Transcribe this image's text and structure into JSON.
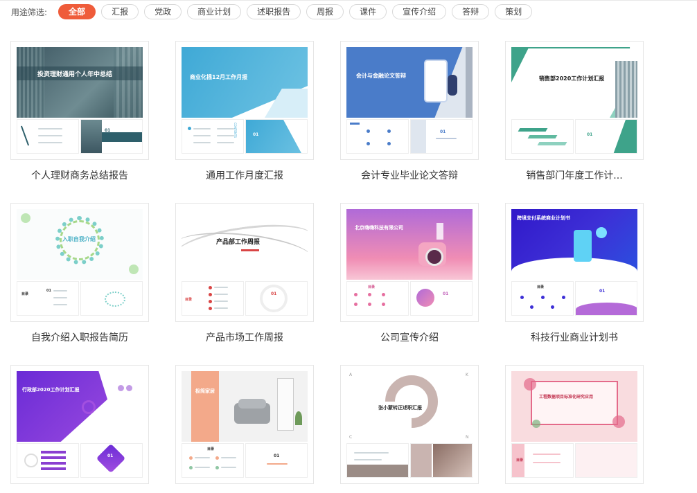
{
  "filter": {
    "label": "用途筛选:",
    "chips": [
      "全部",
      "汇报",
      "党政",
      "商业计划",
      "述职报告",
      "周报",
      "课件",
      "宣传介绍",
      "答辩",
      "策划"
    ],
    "active": "全部"
  },
  "cards": [
    {
      "title": "个人理财商务总结报告",
      "slide_title": "投资理财通用个人年中总结",
      "accent": "#2e5f6b"
    },
    {
      "title": "通用工作月度汇报",
      "slide_title": "商业化插12月工作月报",
      "accent": "#3fa9d6"
    },
    {
      "title": "会计专业毕业论文答辩",
      "slide_title": "会计与金融论文答辩",
      "accent": "#4a7cc9"
    },
    {
      "title": "销售部门年度工作计...",
      "slide_title": "销售部2020工作计划汇报",
      "accent": "#3ea38a"
    },
    {
      "title": "自我介绍入职报告简历",
      "slide_title": "入职自我介绍",
      "accent": "#5fbfc6"
    },
    {
      "title": "产品市场工作周报",
      "slide_title": "产品部工作周报",
      "accent": "#d94545"
    },
    {
      "title": "公司宣传介绍",
      "slide_title": "北京嗨嗨科技有限公司",
      "accent": "#c05fb9"
    },
    {
      "title": "科技行业商业计划书",
      "slide_title": "跨境支付系统商业计划书",
      "accent": "#3d2fd6"
    },
    {
      "title": "",
      "slide_title": "行政部2020工作计划汇报",
      "accent": "#8a3fd1"
    },
    {
      "title": "",
      "slide_title": "极简家居",
      "accent": "#f3a98a"
    },
    {
      "title": "",
      "slide_title": "张小蒙转正述职汇报",
      "accent": "#c9b4b0"
    },
    {
      "title": "",
      "slide_title": "工程数据项目标准化研究应用",
      "accent": "#e46a8a"
    }
  ],
  "thumb_labels": {
    "num01": "01",
    "contents": "CONTENTS",
    "mulu": "目录",
    "letters": [
      "A",
      "K",
      "C",
      "N"
    ]
  }
}
